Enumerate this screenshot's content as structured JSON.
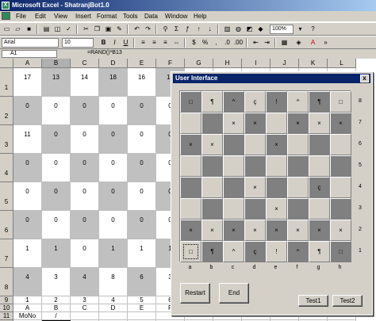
{
  "window": {
    "title": "Microsoft Excel - ShatranjBot1.0"
  },
  "menu": [
    "File",
    "Edit",
    "View",
    "Insert",
    "Format",
    "Tools",
    "Data",
    "Window",
    "Help"
  ],
  "toolbar": {
    "zoom": "100%",
    "font": "Arial",
    "size": "10"
  },
  "formula_bar": {
    "name": "A1",
    "formula": "=RAND()*B13"
  },
  "sheet": {
    "columns": [
      "A",
      "B",
      "C",
      "D",
      "E",
      "F",
      "G",
      "H",
      "I",
      "J",
      "K",
      "L"
    ],
    "rows": [
      "1",
      "2",
      "3",
      "4",
      "5",
      "6",
      "7",
      "8",
      "9",
      "10",
      "11",
      "12"
    ],
    "grid": [
      [
        "17",
        "13",
        "14",
        "18",
        "16",
        "14"
      ],
      [
        "0",
        "0",
        "0",
        "0",
        "0",
        "0"
      ],
      [
        "11",
        "0",
        "0",
        "0",
        "0",
        "0"
      ],
      [
        "0",
        "0",
        "0",
        "0",
        "0",
        "0"
      ],
      [
        "0",
        "0",
        "0",
        "0",
        "0",
        "0"
      ],
      [
        "0",
        "0",
        "0",
        "0",
        "0",
        "0"
      ],
      [
        "1",
        "1",
        "0",
        "1",
        "1",
        "1"
      ],
      [
        "4",
        "3",
        "4",
        "8",
        "6",
        "3"
      ]
    ],
    "row9": [
      "1",
      "2",
      "3",
      "4",
      "5",
      "6"
    ],
    "row10": [
      "A",
      "B",
      "C",
      "D",
      "E",
      "F"
    ],
    "row11": [
      "MoNo",
      "/",
      "",
      "",
      "",
      ""
    ],
    "row12": [
      "Rand",
      "4.124",
      "",
      "Flees",
      "White",
      "Black"
    ]
  },
  "dialog": {
    "title": "User Interface",
    "close": "x",
    "ranks": [
      "8",
      "7",
      "6",
      "5",
      "4",
      "3",
      "2",
      "1"
    ],
    "files": [
      "a",
      "b",
      "c",
      "d",
      "e",
      "f",
      "g",
      "h"
    ],
    "board": [
      [
        "□",
        "¶",
        "^",
        "ç",
        "!",
        "^",
        "¶",
        "□"
      ],
      [
        "",
        "",
        "×",
        "×",
        "",
        "×",
        "×",
        "×"
      ],
      [
        "×",
        "×",
        "",
        "",
        "×",
        "",
        "",
        ""
      ],
      [
        "",
        "",
        "",
        "",
        "",
        "",
        "",
        ""
      ],
      [
        "",
        "",
        "",
        "×",
        "",
        "",
        "ç",
        ""
      ],
      [
        "",
        "",
        "",
        "",
        "×",
        "",
        "",
        ""
      ],
      [
        "×",
        "×",
        "×",
        "×",
        "×",
        "×",
        "×",
        "×"
      ],
      [
        "□",
        "¶",
        "^",
        "ç",
        "!",
        "^",
        "¶",
        "□"
      ]
    ],
    "buttons": {
      "restart": "Restart",
      "end": "End",
      "test1": "Test1",
      "test2": "Test2"
    }
  },
  "colors": {
    "dark_square": "#808080",
    "light_square": "#d4d0c8",
    "title_bar": "#0a246a"
  }
}
